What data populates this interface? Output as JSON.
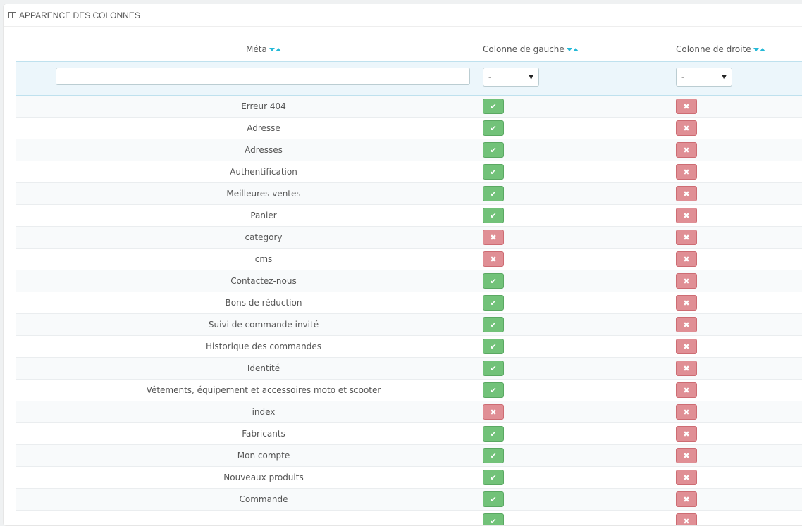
{
  "panel": {
    "title": "APPARENCE DES COLONNES",
    "title_icon": "columns-icon"
  },
  "table": {
    "headers": {
      "meta": "Méta",
      "left": "Colonne de gauche",
      "right": "Colonne de droite"
    },
    "filters": {
      "meta_value": "",
      "left_value": "-",
      "right_value": "-"
    },
    "rows": [
      {
        "meta": "Erreur 404",
        "left": true,
        "right": false
      },
      {
        "meta": "Adresse",
        "left": true,
        "right": false
      },
      {
        "meta": "Adresses",
        "left": true,
        "right": false
      },
      {
        "meta": "Authentification",
        "left": true,
        "right": false
      },
      {
        "meta": "Meilleures ventes",
        "left": true,
        "right": false
      },
      {
        "meta": "Panier",
        "left": true,
        "right": false
      },
      {
        "meta": "category",
        "left": false,
        "right": false
      },
      {
        "meta": "cms",
        "left": false,
        "right": false
      },
      {
        "meta": "Contactez-nous",
        "left": true,
        "right": false
      },
      {
        "meta": "Bons de réduction",
        "left": true,
        "right": false
      },
      {
        "meta": "Suivi de commande invité",
        "left": true,
        "right": false
      },
      {
        "meta": "Historique des commandes",
        "left": true,
        "right": false
      },
      {
        "meta": "Identité",
        "left": true,
        "right": false
      },
      {
        "meta": "Vêtements, équipement et accessoires moto et scooter",
        "left": true,
        "right": false
      },
      {
        "meta": "index",
        "left": false,
        "right": false
      },
      {
        "meta": "Fabricants",
        "left": true,
        "right": false
      },
      {
        "meta": "Mon compte",
        "left": true,
        "right": false
      },
      {
        "meta": "Nouveaux produits",
        "left": true,
        "right": false
      },
      {
        "meta": "Commande",
        "left": true,
        "right": false
      },
      {
        "meta": "",
        "left": true,
        "right": false
      }
    ]
  },
  "icons": {
    "enabled": "check-icon",
    "disabled": "cross-icon",
    "sort_desc": "sort-desc-icon",
    "sort_asc": "sort-asc-icon"
  },
  "colors": {
    "enabled_bg": "#72c279",
    "disabled_bg": "#e08f95",
    "sort_arrow": "#25b9d7",
    "filter_row_bg": "#ecf6fb"
  }
}
